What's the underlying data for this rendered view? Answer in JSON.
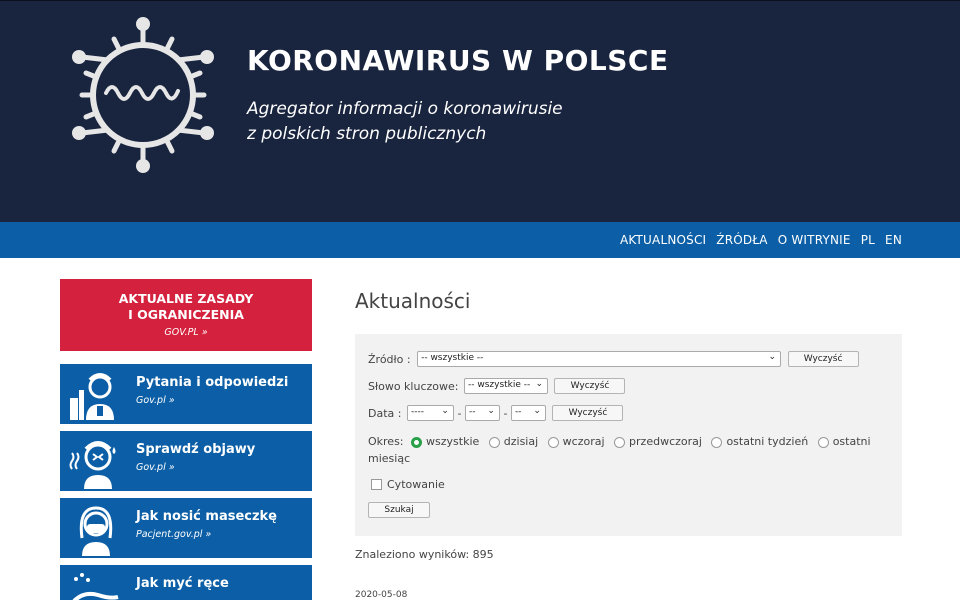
{
  "header": {
    "title": "KORONAWIRUS W POLSCE",
    "subtitle_line1": "Agregator informacji o koronawirusie",
    "subtitle_line2": "z polskich stron publicznych",
    "logo_icon": "coronavirus-icon"
  },
  "nav": {
    "items": [
      "AKTUALNOŚCI",
      "ŹRÓDŁA",
      "O WITRYNIE",
      "PL",
      "EN"
    ]
  },
  "sidebar": {
    "rules_card": {
      "title_line1": "AKTUALNE ZASADY",
      "title_line2": "I OGRANICZENIA",
      "source": "GOV.PL »",
      "color": "#d4213d"
    },
    "cards": [
      {
        "title": "Pytania i odpowiedzi",
        "source": "Gov.pl »",
        "icon": "doctor-icon"
      },
      {
        "title": "Sprawdź objawy",
        "source": "Gov.pl »",
        "icon": "sick-person-icon"
      },
      {
        "title": "Jak nosić maseczkę",
        "source": "Pacjent.gov.pl »",
        "icon": "mask-person-icon"
      },
      {
        "title": "Jak myć ręce",
        "source": "",
        "icon": "hand-washing-icon"
      }
    ],
    "card_color": "#0c5fa6"
  },
  "main": {
    "title": "Aktualności",
    "filter": {
      "source_label": "Źródło :",
      "source_value": "-- wszystkie --",
      "keyword_label": "Słowo kluczowe:",
      "keyword_value": "-- wszystkie --",
      "date_label": "Data :",
      "date_year": "----",
      "date_month": "--",
      "date_day": "--",
      "date_sep": "-",
      "clear_label": "Wyczyść",
      "period_label": "Okres:",
      "period_options": [
        "wszystkie",
        "dzisiaj",
        "wczoraj",
        "przedwczoraj",
        "ostatni tydzień",
        "ostatni"
      ],
      "period_wrap": "miesiąc",
      "period_selected": "wszystkie",
      "quote_label": "Cytowanie",
      "search_label": "Szukaj"
    },
    "results": "Znaleziono wyników: 895",
    "first_date": "2020-05-08"
  },
  "colors": {
    "header_bg": "#19243f",
    "nav_bg": "#0c5fa6",
    "radio_selected": "#27a047"
  }
}
